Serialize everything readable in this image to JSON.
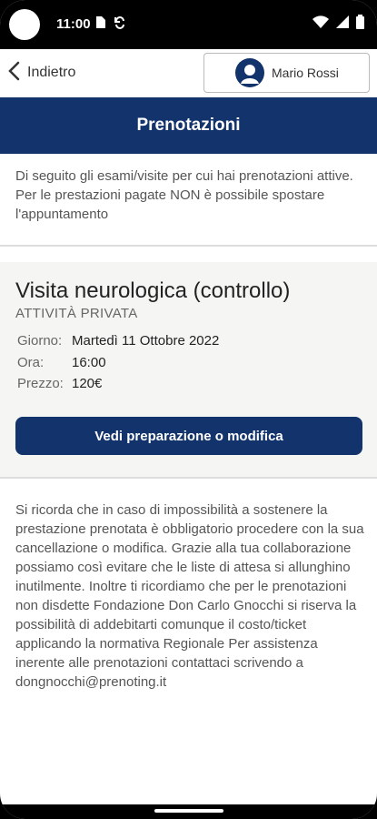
{
  "status_bar": {
    "time": "11:00",
    "icons_left": [
      "sim-icon",
      "sync-icon"
    ],
    "icons_right": [
      "wifi-icon",
      "signal-icon",
      "battery-icon"
    ]
  },
  "header": {
    "back_label": "Indietro",
    "user_name": "Mario Rossi"
  },
  "page_title": "Prenotazioni",
  "intro_text": "Di seguito gli esami/visite per cui hai prenotazioni attive. Per le prestazioni pagate NON è possibile spostare l'appuntamento",
  "booking": {
    "title": "Visita neurologica (controllo)",
    "type": "ATTIVITÀ PRIVATA",
    "date_label": "Giorno:",
    "date_value": "Martedì 11 Ottobre 2022",
    "time_label": "Ora:",
    "time_value": "16:00",
    "price_label": "Prezzo:",
    "price_value": "120€",
    "action_label": "Vedi preparazione o modifica"
  },
  "notice_text": "Si ricorda che in caso di impossibilità a sostenere la prestazione prenotata è obbligatorio procedere con la sua cancellazione o modifica. Grazie alla tua collaborazione possiamo così evitare che le liste di attesa si allunghino inutilmente. Inoltre ti ricordiamo che per le prenotazioni non disdette Fondazione Don Carlo Gnocchi si riserva la possibilità di addebitarti comunque il costo/ticket applicando la normativa Regionale Per assistenza inerente alle prenotazioni contattaci scrivendo a dongnocchi@prenoting.it",
  "colors": {
    "brand": "#12336b",
    "card_bg": "#f5f6f3"
  }
}
